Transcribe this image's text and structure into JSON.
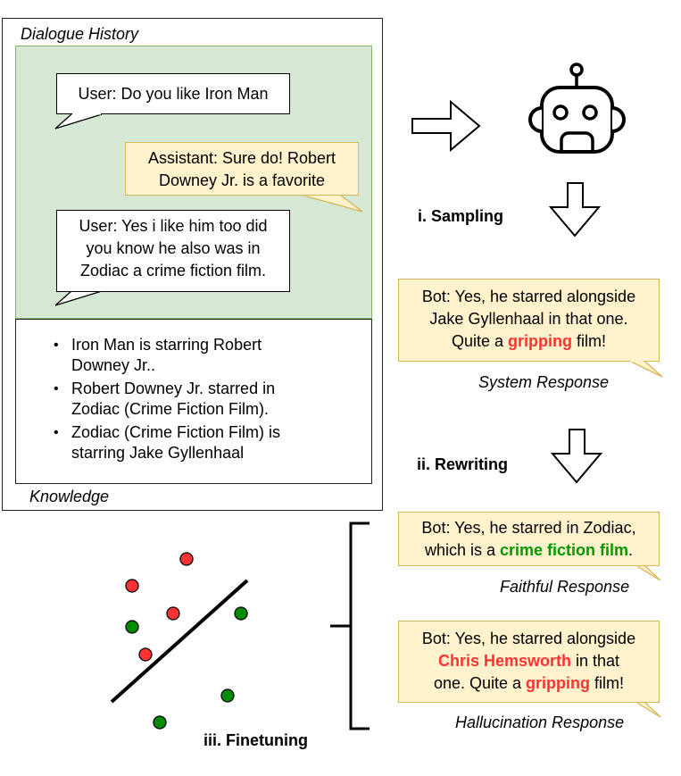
{
  "dialogue_history": {
    "title": "Dialogue History",
    "turns": [
      {
        "speaker": "user",
        "text": "User: Do you like Iron Man"
      },
      {
        "speaker": "assistant",
        "lines": [
          "Assistant: Sure do! Robert",
          "Downey Jr. is a favorite"
        ]
      },
      {
        "speaker": "user",
        "lines": [
          "User: Yes i like him too did",
          "you know he also was in",
          "Zodiac a crime fiction film."
        ]
      }
    ]
  },
  "knowledge": {
    "title": "Knowledge",
    "items": [
      {
        "lines": [
          "Iron Man is starring Robert",
          "Downey Jr.."
        ]
      },
      {
        "lines": [
          "Robert Downey Jr. starred in",
          "Zodiac (Crime Fiction Film)."
        ]
      },
      {
        "lines": [
          "Zodiac (Crime Fiction Film) is",
          "starring Jake Gyllenhaal"
        ]
      }
    ]
  },
  "steps": {
    "sampling": "i. Sampling",
    "rewriting": "ii. Rewriting",
    "finetuning": "iii. Finetuning"
  },
  "system_response": {
    "label": "System Response",
    "line1": "Bot: Yes, he starred alongside",
    "line2": "Jake Gyllenhaal in that one.",
    "line3_pre": "Quite a ",
    "line3_highlight": "gripping",
    "line3_post": " film!"
  },
  "faithful_response": {
    "label": "Faithful Response",
    "line1": "Bot: Yes, he starred in Zodiac,",
    "line2_pre": "which is a ",
    "line2_highlight": "crime fiction film",
    "line2_post": "."
  },
  "hallucination_response": {
    "label": "Hallucination Response",
    "line1": "Bot: Yes, he starred alongside",
    "line2_highlight": "Chris Hemsworth",
    "line2_post": " in that",
    "line3_pre": "one. Quite a ",
    "line3_highlight": "gripping",
    "line3_post": " film!"
  },
  "colors": {
    "dialogue_bg": "#d5e8d4",
    "dialogue_border": "#82b366",
    "bubble_yellow": "#fff2cc",
    "bubble_yellow_border": "#d6b656",
    "hallucination_red": "#ff3333",
    "faithful_green": "#009900"
  },
  "icons": {
    "robot": "robot-icon",
    "arrow_right": "arrow-right-icon",
    "arrow_down": "arrow-down-icon"
  }
}
